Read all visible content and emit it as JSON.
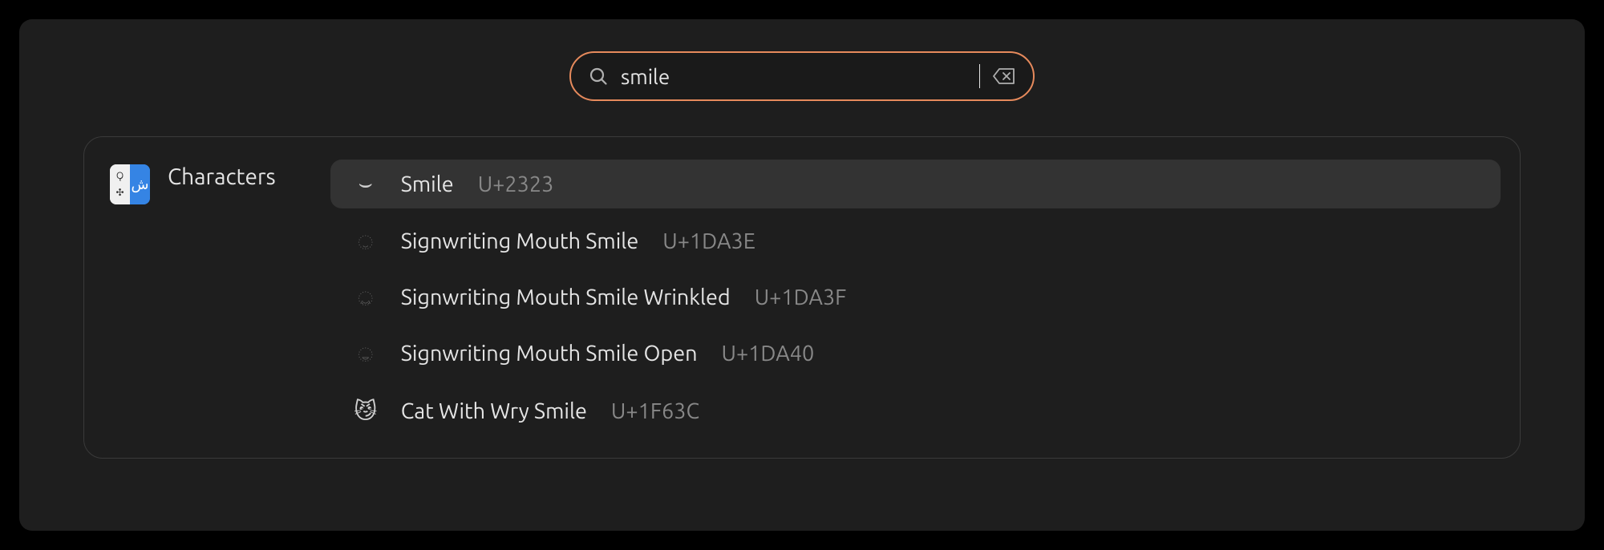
{
  "search": {
    "value": "smile",
    "placeholder": ""
  },
  "category": {
    "label": "Characters"
  },
  "results": [
    {
      "glyph": "⌣",
      "glyph_dim": false,
      "name": "Smile",
      "code": "U+2323",
      "selected": true
    },
    {
      "glyph": "𝨾",
      "glyph_dim": true,
      "name": "Signwriting Mouth Smile",
      "code": "U+1DA3E",
      "selected": false
    },
    {
      "glyph": "𝨿",
      "glyph_dim": true,
      "name": "Signwriting Mouth Smile Wrinkled",
      "code": "U+1DA3F",
      "selected": false
    },
    {
      "glyph": "𝩀",
      "glyph_dim": true,
      "name": "Signwriting Mouth Smile Open",
      "code": "U+1DA40",
      "selected": false
    },
    {
      "glyph": "😼",
      "glyph_dim": false,
      "name": "Cat With Wry Smile",
      "code": "U+1F63C",
      "selected": false
    }
  ]
}
